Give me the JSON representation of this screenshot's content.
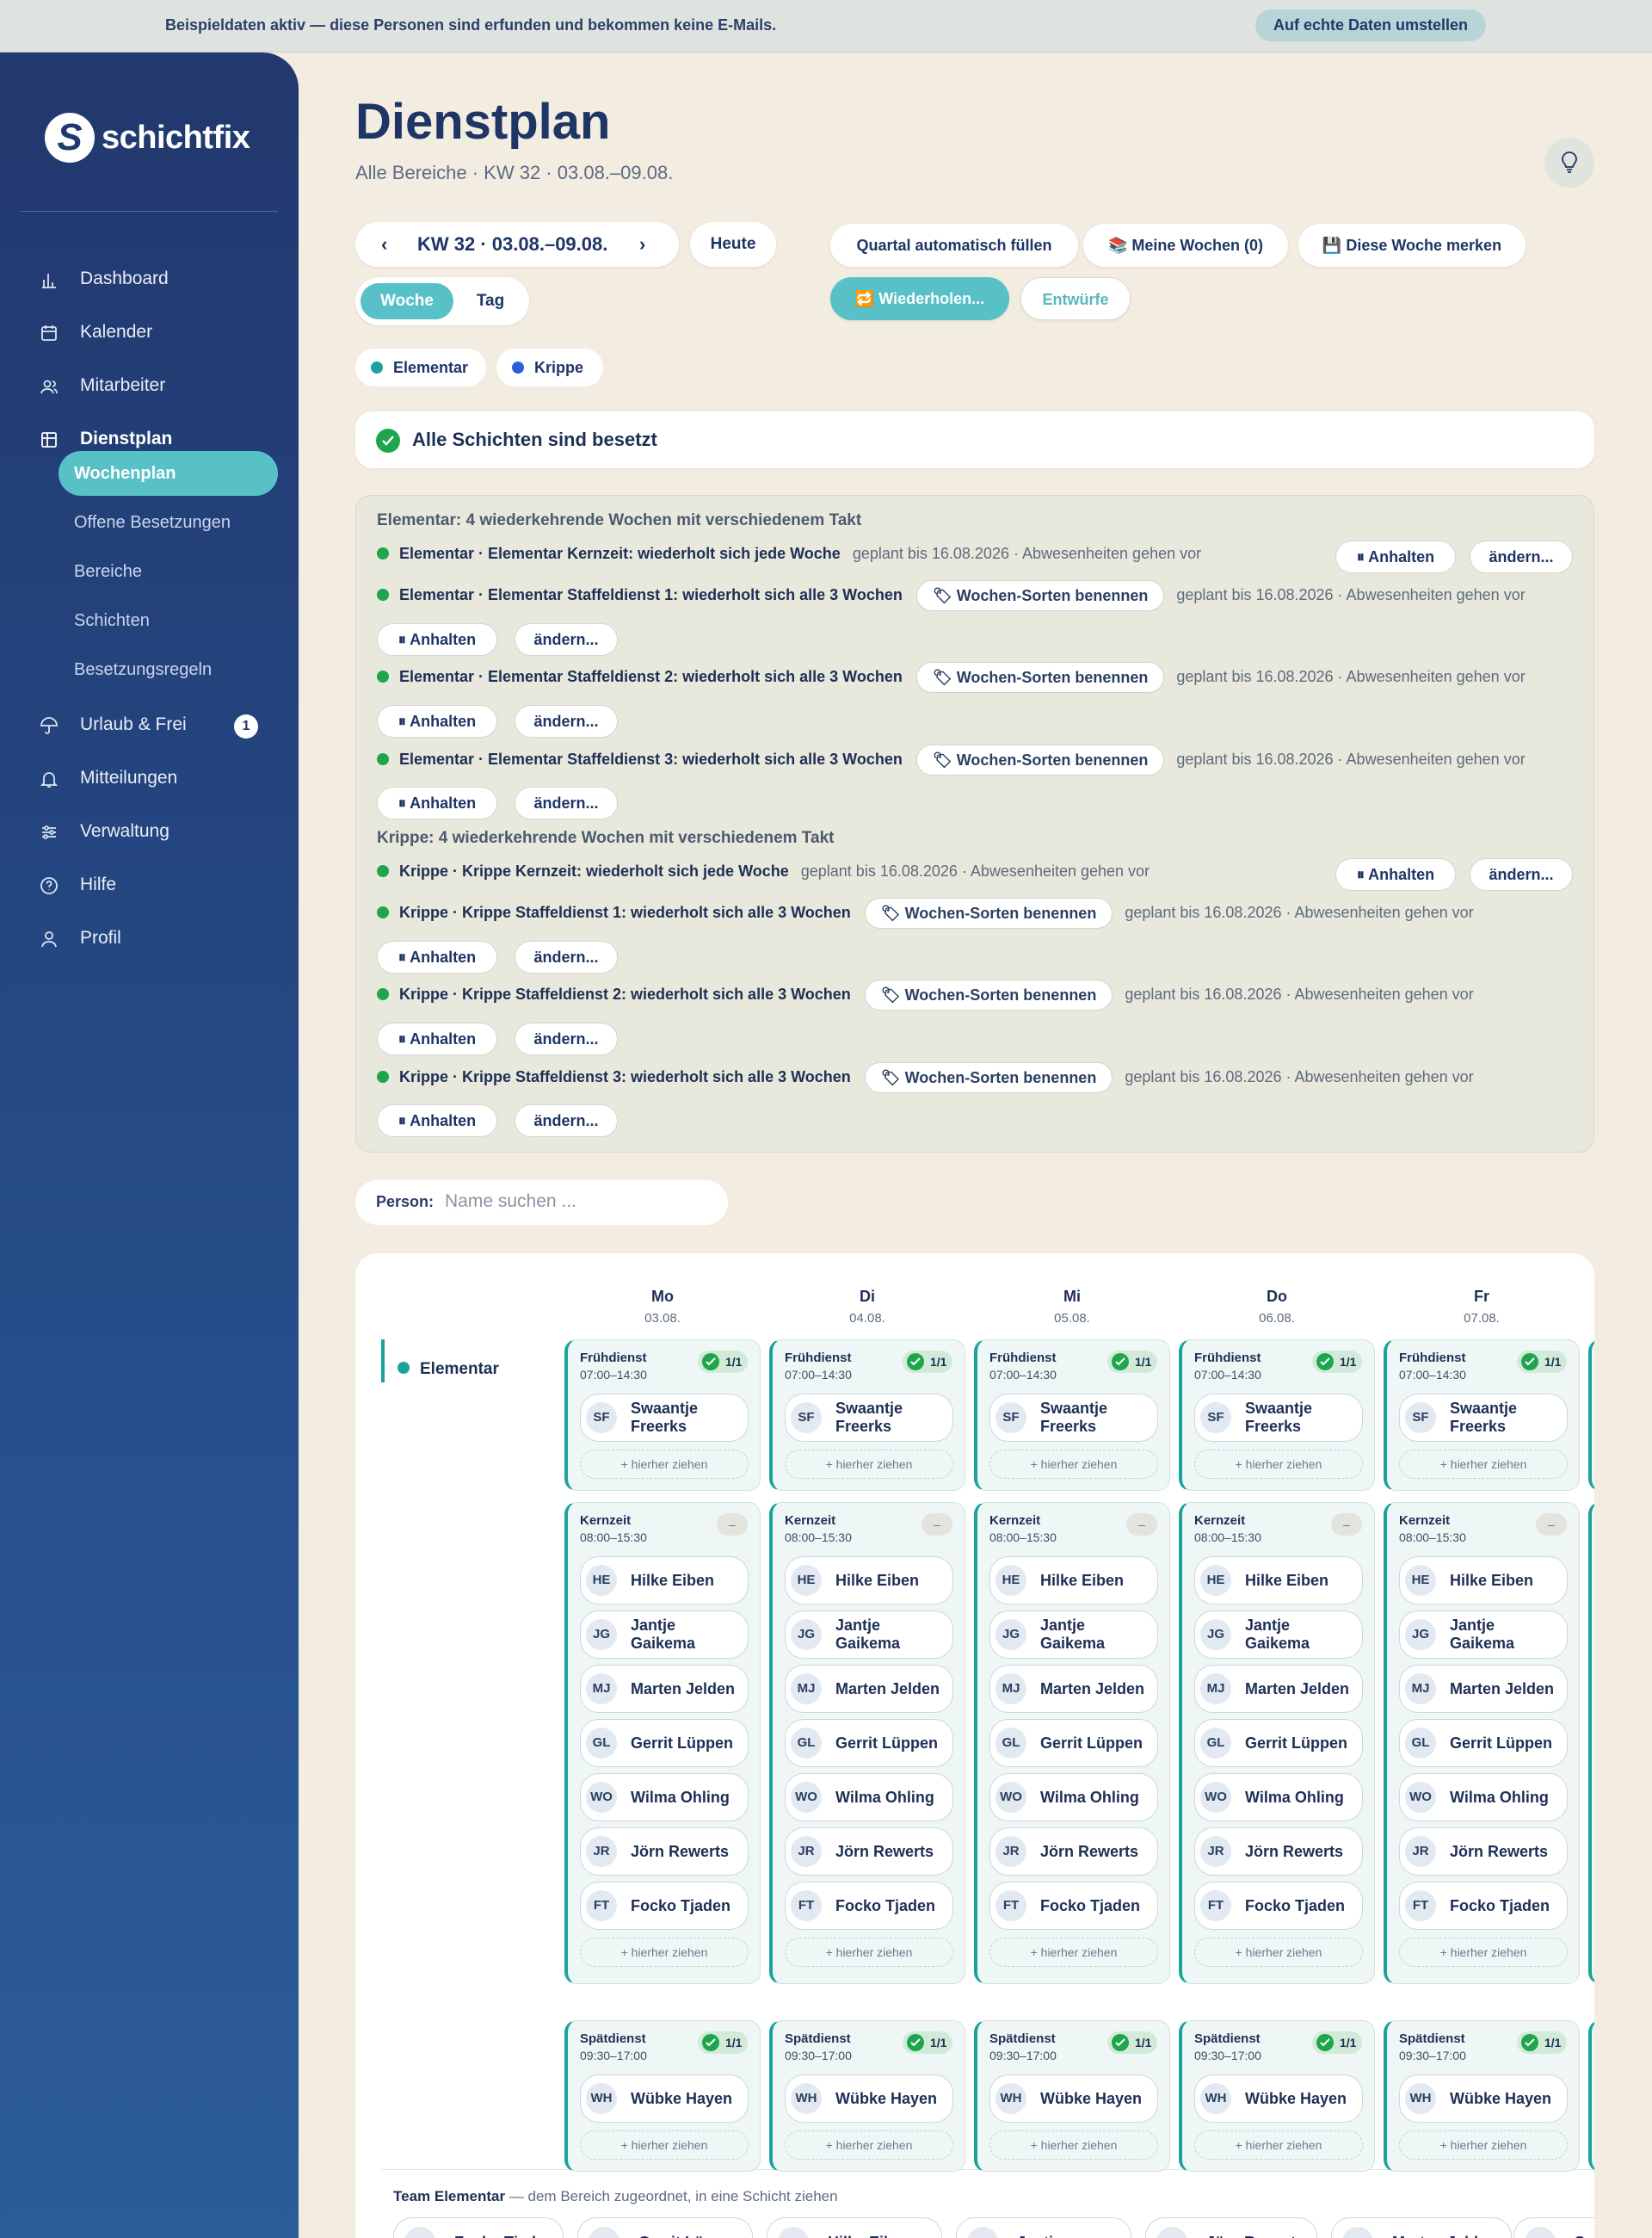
{
  "banner": {
    "text": "Beispieldaten aktiv — diese Personen sind erfunden und bekommen keine E-Mails.",
    "button": "Auf echte Daten umstellen"
  },
  "brand": {
    "name": "schichtfix"
  },
  "nav": {
    "items": [
      {
        "label": "Dashboard",
        "icon": "chart-icon"
      },
      {
        "label": "Kalender",
        "icon": "calendar-icon"
      },
      {
        "label": "Mitarbeiter",
        "icon": "users-icon"
      },
      {
        "label": "Dienstplan",
        "icon": "grid-icon"
      },
      {
        "label": "Urlaub & Frei",
        "icon": "umbrella-icon",
        "badge": "1"
      },
      {
        "label": "Mitteilungen",
        "icon": "bell-icon"
      },
      {
        "label": "Verwaltung",
        "icon": "sliders-icon"
      },
      {
        "label": "Hilfe",
        "icon": "help-icon"
      },
      {
        "label": "Profil",
        "icon": "user-icon"
      }
    ],
    "sub": [
      "Wochenplan",
      "Offene Besetzungen",
      "Bereiche",
      "Schichten",
      "Besetzungsregeln"
    ]
  },
  "page": {
    "title": "Dienstplan",
    "subtitle": "Alle Bereiche · KW 32 · 03.08.–09.08."
  },
  "toolbar": {
    "week_label": "KW 32 · 03.08.–09.08.",
    "prev": "‹",
    "next": "›",
    "today": "Heute",
    "view_week": "Woche",
    "view_day": "Tag",
    "fill_quarter": "Quartal automatisch füllen",
    "my_weeks": "📚 Meine Wochen (0)",
    "remember_week": "💾 Diese Woche merken",
    "repeat": "🔁 Wiederholen...",
    "drafts": "Entwürfe"
  },
  "legend": [
    {
      "label": "Elementar",
      "color": "#1aa39a"
    },
    {
      "label": "Krippe",
      "color": "#2b5fd9"
    }
  ],
  "status": {
    "text": "Alle Schichten sind besetzt"
  },
  "recurring": {
    "pause": "⏸ Anhalten",
    "change": "ändern...",
    "rename": "🏷 Wochen-Sorten benennen",
    "meta": "geplant bis 16.08.2026 · Abwesenheiten gehen vor",
    "groups": [
      {
        "title": "Elementar: 4 wiederkehrende Wochen mit verschiedenem Takt",
        "rules": [
          "Elementar · Elementar Kernzeit: wiederholt sich jede Woche",
          "Elementar · Elementar Staffeldienst 1: wiederholt sich alle 3 Wochen",
          "Elementar · Elementar Staffeldienst 2: wiederholt sich alle 3 Wochen",
          "Elementar · Elementar Staffeldienst 3: wiederholt sich alle 3 Wochen"
        ]
      },
      {
        "title": "Krippe: 4 wiederkehrende Wochen mit verschiedenem Takt",
        "rules": [
          "Krippe · Krippe Kernzeit: wiederholt sich jede Woche",
          "Krippe · Krippe Staffeldienst 1: wiederholt sich alle 3 Wochen",
          "Krippe · Krippe Staffeldienst 2: wiederholt sich alle 3 Wochen",
          "Krippe · Krippe Staffeldienst 3: wiederholt sich alle 3 Wochen"
        ]
      }
    ]
  },
  "search": {
    "label": "Person:",
    "placeholder": "Name suchen ..."
  },
  "schedule": {
    "area": "Elementar",
    "days": [
      {
        "day": "Mo",
        "date": "03.08."
      },
      {
        "day": "Di",
        "date": "04.08."
      },
      {
        "day": "Mi",
        "date": "05.08."
      },
      {
        "day": "Do",
        "date": "06.08."
      },
      {
        "day": "Fr",
        "date": "07.08."
      }
    ],
    "drop_hint": "+ hierher ziehen",
    "shifts": [
      {
        "name": "Frühdienst",
        "time": "07:00–14:30",
        "badge": "1/1",
        "people": [
          {
            "initials": "SF",
            "name": "Swaantje Freerks"
          }
        ]
      },
      {
        "name": "Kernzeit",
        "time": "08:00–15:30",
        "badge": "–",
        "people": [
          {
            "initials": "HE",
            "name": "Hilke Eiben"
          },
          {
            "initials": "JG",
            "name": "Jantje Gaikema"
          },
          {
            "initials": "MJ",
            "name": "Marten Jelden"
          },
          {
            "initials": "GL",
            "name": "Gerrit Lüppen"
          },
          {
            "initials": "WO",
            "name": "Wilma Ohling"
          },
          {
            "initials": "JR",
            "name": "Jörn Rewerts"
          },
          {
            "initials": "FT",
            "name": "Focko Tjaden"
          }
        ]
      },
      {
        "name": "Spätdienst",
        "time": "09:30–17:00",
        "badge": "1/1",
        "people": [
          {
            "initials": "WH",
            "name": "Wübke Hayen"
          }
        ]
      }
    ],
    "team_title": "Team Elementar",
    "team_note": " — dem Bereich zugeordnet, in eine Schicht ziehen",
    "team": [
      "Focko Tjaden",
      "Gerrit Lüppen",
      "Hilke Eiben",
      "Jantje Gaikema",
      "Jörn Rewerts",
      "Marten Jelden",
      "Sw..."
    ]
  }
}
